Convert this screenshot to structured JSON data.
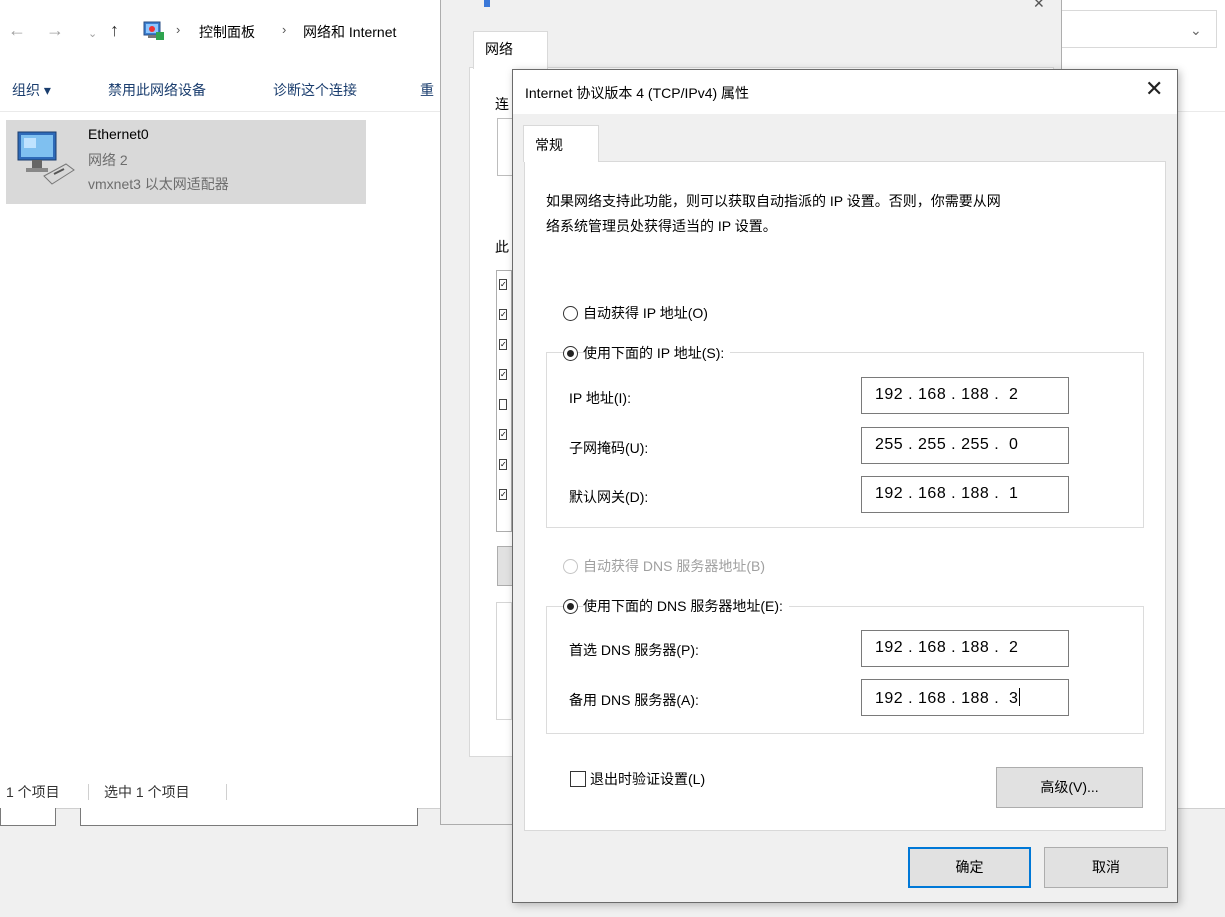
{
  "explorer": {
    "breadcrumb": [
      "控制面板",
      "网络和 Internet"
    ],
    "toolbar": [
      "组织 ▾",
      "禁用此网络设备",
      "诊断这个连接",
      "重"
    ],
    "adapter": {
      "name": "Ethernet0",
      "network": "网络 2",
      "device": "vmxnet3 以太网适配器"
    },
    "status": {
      "count": "1 个项目",
      "selected": "选中 1 个项目"
    }
  },
  "eth_dialog": {
    "tab": "网络",
    "label_conn": "连",
    "label_uses": "此",
    "checked_items": [
      true,
      true,
      true,
      true,
      false,
      true,
      true,
      true
    ]
  },
  "ip_dialog": {
    "title": "Internet 协议版本 4 (TCP/IPv4) 属性",
    "close": "✕",
    "tab": "常规",
    "description": [
      "如果网络支持此功能，则可以获取自动指派的 IP 设置。否则，你需要从网",
      "络系统管理员处获得适当的 IP 设置。"
    ],
    "auto_ip_label": "自动获得 IP 地址(O)",
    "manual_ip_label": "使用下面的 IP 地址(S):",
    "ip_label": "IP 地址(I):",
    "ip_value": "192 . 168 . 188 .  2",
    "mask_label": "子网掩码(U):",
    "mask_value": "255 . 255 . 255 .  0",
    "gateway_label": "默认网关(D):",
    "gateway_value": "192 . 168 . 188 .  1",
    "auto_dns_label": "自动获得 DNS 服务器地址(B)",
    "manual_dns_label": "使用下面的 DNS 服务器地址(E):",
    "preferred_dns_label": "首选 DNS 服务器(P):",
    "preferred_dns_value": "192 . 168 . 188 .  2",
    "alternate_dns_label": "备用 DNS 服务器(A):",
    "alternate_dns_value": "192 . 168 . 188 .  3",
    "validate_label": "退出时验证设置(L)",
    "advanced_button": "高级(V)...",
    "ok_button": "确定",
    "cancel_button": "取消"
  }
}
